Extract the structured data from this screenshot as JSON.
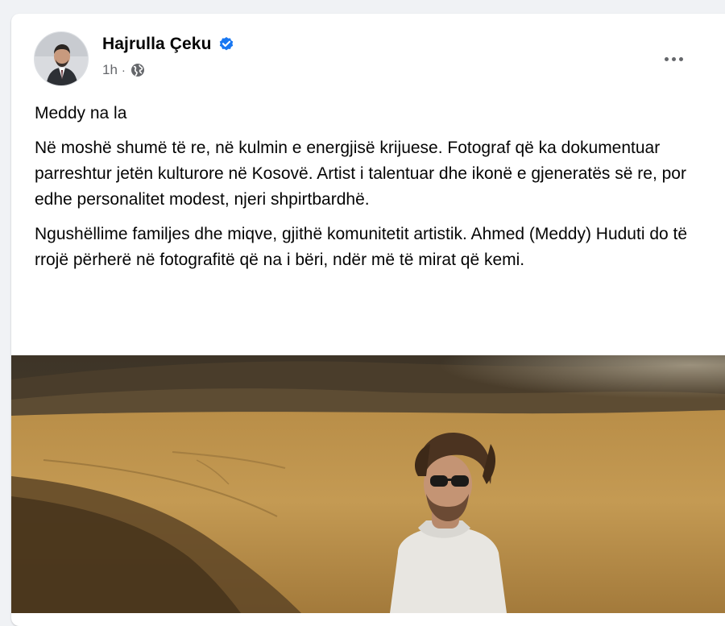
{
  "post": {
    "author": "Hajrulla Çeku",
    "timestamp": "1h",
    "separator": "·",
    "verified_icon": "verified-badge-icon",
    "privacy_icon": "globe-icon",
    "more_icon": "more-options-icon",
    "paragraphs": [
      "Meddy na la",
      "Në moshë shumë të re, në kulmin e energjisë krijuese. Fotograf që ka dokumentuar parreshtur jetën kulturore në Kosovë. Artist i talentuar dhe ikonë e gjeneratës së re, por edhe personalitet modest, njeri shpirtbardhë.",
      "Ngushëllime familjes dhe miqve, gjithë komunitetit artistik. Ahmed (Meddy) Huduti do të rrojë përherë në fotografitë që na i bëri, ndër më të mirat që kemi."
    ]
  },
  "colors": {
    "page_bg": "#f0f2f5",
    "card_bg": "#ffffff",
    "text": "#050505",
    "secondary_text": "#65676b",
    "verified_blue": "#1877f2"
  }
}
